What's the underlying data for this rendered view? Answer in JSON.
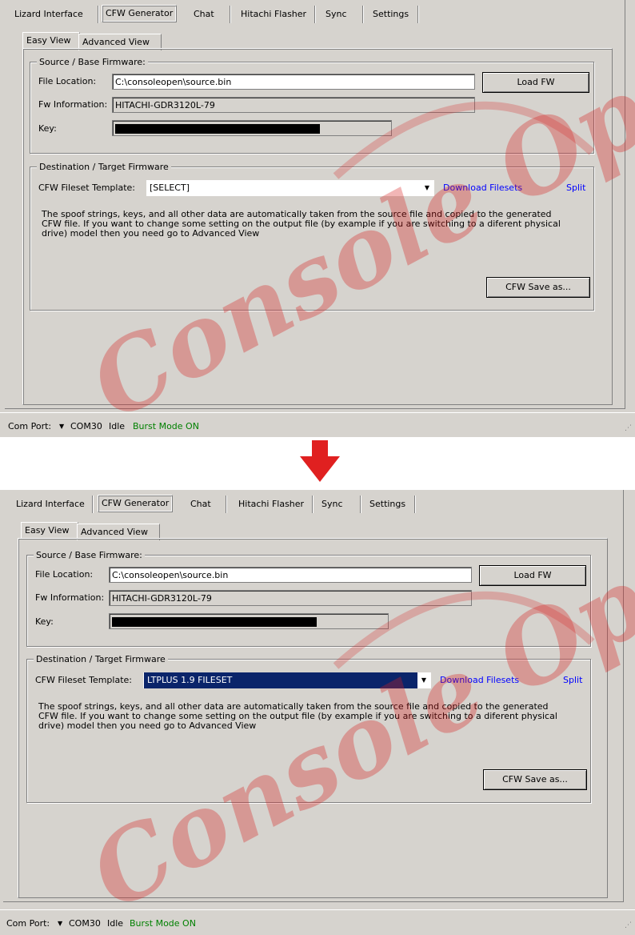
{
  "top_tabs": [
    "Lizard Interface",
    "CFW Generator",
    "Chat",
    "Hitachi Flasher",
    "Sync",
    "Settings"
  ],
  "sub_tabs": [
    "Easy View",
    "Advanced View"
  ],
  "source_group": {
    "legend": "Source / Base Firmware:",
    "file_location_label": "File Location:",
    "file_location_value": "C:\\consoleopen\\source.bin",
    "load_button": "Load FW",
    "fw_info_label": "Fw Information:",
    "fw_info_value": "HITACHI-GDR3120L-79",
    "key_label": "Key:"
  },
  "dest_group": {
    "legend": "Destination / Target Firmware",
    "template_label": "CFW Fileset Template:",
    "download_link": "Download Filesets",
    "split_link": "Split",
    "description": "The spoof strings, keys, and all other data are automatically taken from the source file and copied to the generated CFW file.  If you want to change some setting on the output file (by example if you are switching to a diferent physical drive) model then you need go to Advanced View",
    "save_button": "CFW Save as..."
  },
  "statusbar": {
    "com_port_label": "Com Port:",
    "com_port_value": "COM30",
    "state": "Idle",
    "burst": "Burst Mode ON"
  },
  "screens": [
    {
      "template_value": "[SELECT]"
    },
    {
      "template_value": "LTPLUS 1.9 FILESET"
    }
  ],
  "watermark": {
    "text": "Console Open"
  },
  "colors": {
    "link": "#0000ff",
    "burst": "#008000",
    "selection": "#0a246a",
    "arrow": "#e02020",
    "window": "#d6d3ce"
  }
}
